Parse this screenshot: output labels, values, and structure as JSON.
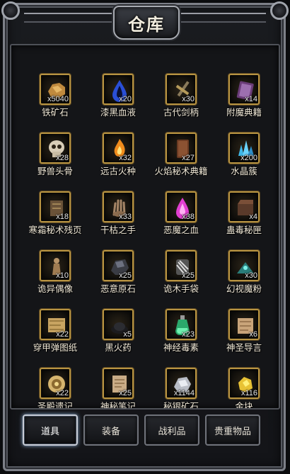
{
  "window": {
    "title": "仓库"
  },
  "colors": {
    "slot_border": "#b89442",
    "frame": "#7d8088",
    "active_tab_glow": "#8fb1d6"
  },
  "items": [
    {
      "name": "铁矿石",
      "qty": "x5040",
      "icon": "iron-ore-icon"
    },
    {
      "name": "漆黑血液",
      "qty": "x20",
      "icon": "dark-blood-icon"
    },
    {
      "name": "古代剑柄",
      "qty": "x30",
      "icon": "ancient-hilt-icon"
    },
    {
      "name": "附魔典籍",
      "qty": "x14",
      "icon": "enchant-book-icon"
    },
    {
      "name": "野兽头骨",
      "qty": "x28",
      "icon": "beast-skull-icon"
    },
    {
      "name": "远古火种",
      "qty": "x32",
      "icon": "ancient-ember-icon"
    },
    {
      "name": "火焰秘术典籍",
      "qty": "x27",
      "icon": "fire-tome-icon"
    },
    {
      "name": "水晶簇",
      "qty": "x200",
      "icon": "crystal-cluster-icon"
    },
    {
      "name": "寒霜秘术残页",
      "qty": "x18",
      "icon": "frost-page-icon"
    },
    {
      "name": "干枯之手",
      "qty": "x33",
      "icon": "withered-hand-icon"
    },
    {
      "name": "恶魔之血",
      "qty": "x38",
      "icon": "demon-blood-icon"
    },
    {
      "name": "蛊毒秘匣",
      "qty": "x4",
      "icon": "poison-box-icon"
    },
    {
      "name": "诡异偶像",
      "qty": "x10",
      "icon": "strange-idol-icon"
    },
    {
      "name": "恶意原石",
      "qty": "x25",
      "icon": "malice-stone-icon"
    },
    {
      "name": "诡木手袋",
      "qty": "x25",
      "icon": "wood-pouch-icon"
    },
    {
      "name": "幻视魔粉",
      "qty": "x30",
      "icon": "illusion-powder-icon"
    },
    {
      "name": "穿甲弹图纸",
      "qty": "x22",
      "icon": "blueprint-icon"
    },
    {
      "name": "黑火药",
      "qty": "x5",
      "icon": "black-powder-icon"
    },
    {
      "name": "神经毒素",
      "qty": "x23",
      "icon": "neurotoxin-icon"
    },
    {
      "name": "神圣导言",
      "qty": "x6",
      "icon": "holy-scroll-icon"
    },
    {
      "name": "圣殿遗记",
      "qty": "x22",
      "icon": "temple-relic-icon"
    },
    {
      "name": "神秘笔记",
      "qty": "x25",
      "icon": "mystic-notes-icon"
    },
    {
      "name": "秘银矿石",
      "qty": "x1144",
      "icon": "mithril-ore-icon"
    },
    {
      "name": "金块",
      "qty": "x116",
      "icon": "gold-nugget-icon"
    }
  ],
  "tabs": [
    {
      "label": "道具",
      "active": true
    },
    {
      "label": "装备",
      "active": false
    },
    {
      "label": "战利品",
      "active": false
    },
    {
      "label": "贵重物品",
      "active": false
    }
  ]
}
